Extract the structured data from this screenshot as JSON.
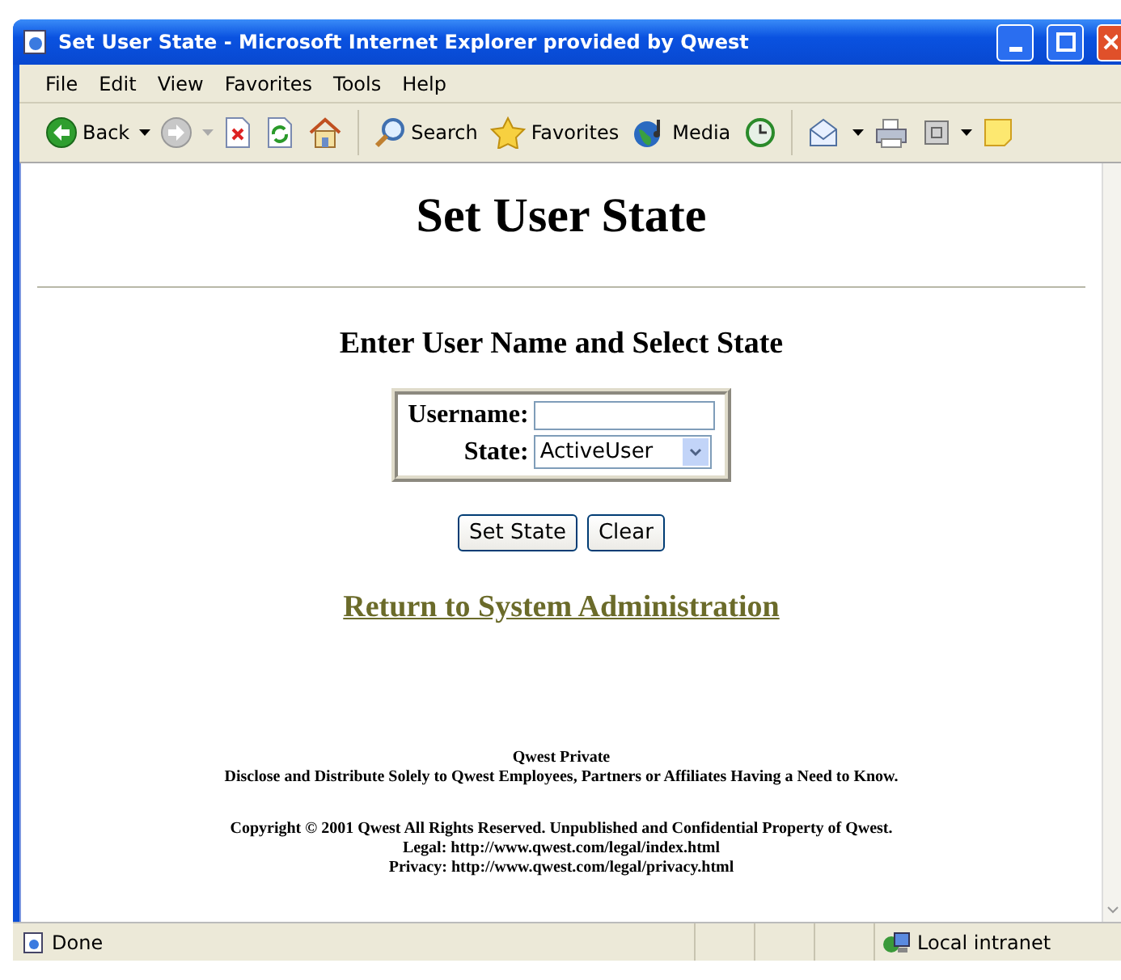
{
  "window": {
    "title": "Set User State - Microsoft Internet Explorer provided by Qwest"
  },
  "menu": [
    "File",
    "Edit",
    "View",
    "Favorites",
    "Tools",
    "Help"
  ],
  "toolbar": [
    {
      "kind": "back",
      "label": "Back"
    },
    {
      "kind": "forward",
      "disabled": true
    },
    {
      "kind": "stop"
    },
    {
      "kind": "refresh"
    },
    {
      "kind": "home"
    },
    {
      "kind": "search",
      "label": "Search"
    },
    {
      "kind": "favorites",
      "label": "Favorites"
    },
    {
      "kind": "media",
      "label": "Media"
    },
    {
      "kind": "history"
    },
    {
      "kind": "mail"
    },
    {
      "kind": "print"
    },
    {
      "kind": "edit"
    },
    {
      "kind": "note"
    }
  ],
  "page": {
    "heading": "Set User State",
    "subheading": "Enter User Name and Select State",
    "form": {
      "username_label": "Username:",
      "state_label": "State:",
      "state_value": "ActiveUser"
    },
    "buttons": [
      "Set State",
      "Clear"
    ],
    "link": "Return to System Administration",
    "footer": [
      "Qwest Private",
      "Disclose and Distribute Solely to Qwest Employees, Partners or Affiliates Having a Need to Know."
    ],
    "copyright": [
      "Copyright © 2001  Qwest All Rights Reserved.  Unpublished and Confidential Property of Qwest.",
      "Legal: http://www.qwest.com/legal/index.html",
      "Privacy: http://www.qwest.com/legal/privacy.html"
    ]
  },
  "status_bar": {
    "status": "Done",
    "zone": "Local intranet"
  }
}
